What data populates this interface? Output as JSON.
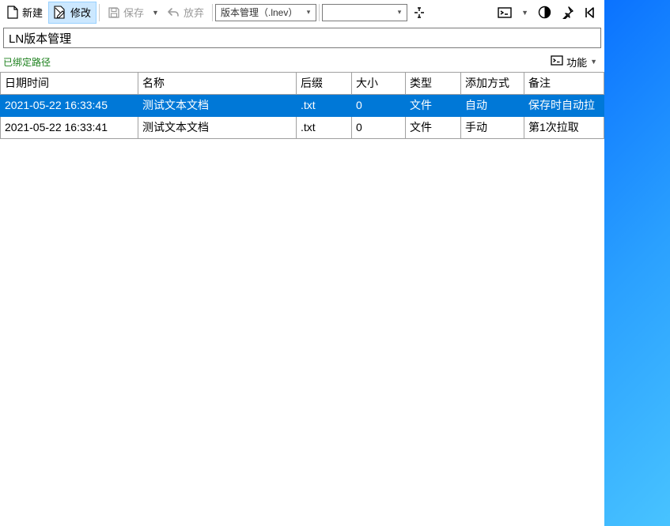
{
  "toolbar": {
    "new_label": "新建",
    "edit_label": "修改",
    "save_label": "保存",
    "discard_label": "放弃",
    "filter_dropdown": "版本管理（.lnev）"
  },
  "title_input": {
    "value": "LN版本管理"
  },
  "status": {
    "bound_text": "已绑定路径",
    "func_label": "功能"
  },
  "table": {
    "headers": {
      "datetime": "日期时间",
      "name": "名称",
      "ext": "后缀",
      "size": "大小",
      "type": "类型",
      "add_mode": "添加方式",
      "remark": "备注"
    },
    "rows": [
      {
        "datetime": "2021-05-22 16:33:45",
        "name": "测试文本文档",
        "ext": ".txt",
        "size": "0",
        "type": "文件",
        "add_mode": "自动",
        "remark": "保存时自动拉",
        "selected": true
      },
      {
        "datetime": "2021-05-22 16:33:41",
        "name": "测试文本文档",
        "ext": ".txt",
        "size": "0",
        "type": "文件",
        "add_mode": "手动",
        "remark": "第1次拉取",
        "selected": false
      }
    ]
  }
}
